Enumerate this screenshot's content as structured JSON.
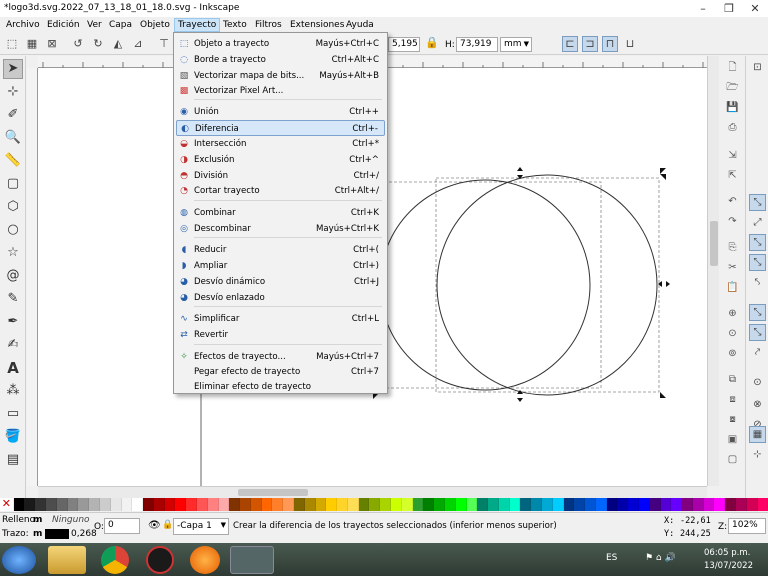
{
  "window": {
    "title": "*logo3d.svg.2022_07_13_18_01_18.0.svg - Inkscape",
    "minimize": "–",
    "restore": "❐",
    "close": "✕"
  },
  "menubar": [
    "Archivo",
    "Edición",
    "Ver",
    "Capa",
    "Objeto",
    "Trayecto",
    "Texto",
    "Filtros",
    "Extensiones",
    "Ayuda"
  ],
  "controls": {
    "x_value": "5,195",
    "h_label": "H:",
    "h_value": "73,919",
    "unit": "mm"
  },
  "dropdown": {
    "items": [
      {
        "label": "Objeto a trayecto",
        "shortcut": "Mayús+Ctrl+C",
        "icon": "object-to-path-icon",
        "color": "#2a5fa8"
      },
      {
        "label": "Borde a trayecto",
        "shortcut": "Ctrl+Alt+C",
        "icon": "stroke-to-path-icon",
        "color": "#2a5fa8"
      },
      {
        "label": "Vectorizar mapa de bits...",
        "shortcut": "Mayús+Alt+B",
        "icon": "trace-bitmap-icon",
        "color": "#555555"
      },
      {
        "label": "Vectorizar Pixel Art...",
        "shortcut": "",
        "icon": "trace-pixelart-icon",
        "color": "#d04040"
      },
      {
        "label": "Unión",
        "shortcut": "Ctrl++",
        "icon": "union-icon",
        "color": "#2a5fa8"
      },
      {
        "label": "Diferencia",
        "shortcut": "Ctrl+-",
        "icon": "difference-icon",
        "color": "#2a5fa8"
      },
      {
        "label": "Intersección",
        "shortcut": "Ctrl+*",
        "icon": "intersection-icon",
        "color": "#c03030"
      },
      {
        "label": "Exclusión",
        "shortcut": "Ctrl+^",
        "icon": "exclusion-icon",
        "color": "#c03030"
      },
      {
        "label": "División",
        "shortcut": "Ctrl+/",
        "icon": "division-icon",
        "color": "#c03030"
      },
      {
        "label": "Cortar trayecto",
        "shortcut": "Ctrl+Alt+/",
        "icon": "cut-path-icon",
        "color": "#c03030"
      },
      {
        "label": "Combinar",
        "shortcut": "Ctrl+K",
        "icon": "combine-icon",
        "color": "#2a5fa8"
      },
      {
        "label": "Descombinar",
        "shortcut": "Mayús+Ctrl+K",
        "icon": "break-apart-icon",
        "color": "#2a5fa8"
      },
      {
        "label": "Reducir",
        "shortcut": "Ctrl+(",
        "icon": "inset-icon",
        "color": "#2a5fa8"
      },
      {
        "label": "Ampliar",
        "shortcut": "Ctrl+)",
        "icon": "outset-icon",
        "color": "#2a5fa8"
      },
      {
        "label": "Desvío dinámico",
        "shortcut": "Ctrl+J",
        "icon": "dynamic-offset-icon",
        "color": "#2a5fa8"
      },
      {
        "label": "Desvío enlazado",
        "shortcut": "",
        "icon": "linked-offset-icon",
        "color": "#2a5fa8"
      },
      {
        "label": "Simplificar",
        "shortcut": "Ctrl+L",
        "icon": "simplify-icon",
        "color": "#2a5fa8"
      },
      {
        "label": "Revertir",
        "shortcut": "",
        "icon": "reverse-icon",
        "color": "#2a5fa8"
      },
      {
        "label": "Efectos de trayecto...",
        "shortcut": "Mayús+Ctrl+7",
        "icon": "path-effects-icon",
        "color": "#2a8a3a"
      },
      {
        "label": "Pegar efecto de trayecto",
        "shortcut": "Ctrl+7",
        "icon": "",
        "color": ""
      },
      {
        "label": "Eliminar efecto de trayecto",
        "shortcut": "",
        "icon": "",
        "color": ""
      }
    ]
  },
  "status": {
    "fill_label": "Relleno:",
    "fill_value": "m",
    "fill_text": "Ninguno",
    "stroke_label": "Trazo:",
    "stroke_value": "m",
    "stroke_width": "0,268",
    "opacity_label": "O:",
    "opacity_value": "0",
    "layer": "-Capa 1",
    "message": "Crear la diferencia de los trayectos seleccionados (inferior menos superior)",
    "x_label": "X:",
    "x_value": "-22,61",
    "y_label": "Y:",
    "y_value": "244,25",
    "zoom_label": "Z:",
    "zoom_value": "102%"
  },
  "taskbar": {
    "lang": "ES",
    "time": "06:05 p.m.",
    "date": "13/07/2022"
  }
}
